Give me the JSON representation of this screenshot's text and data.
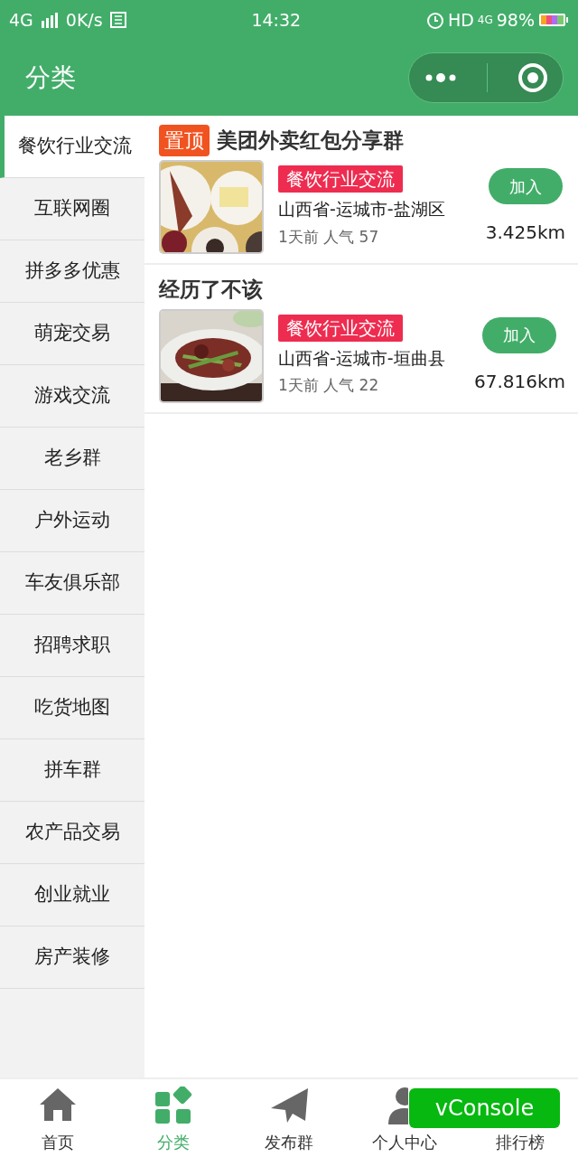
{
  "status_bar": {
    "network": "4G",
    "speed": "0K/s",
    "time": "14:32",
    "hd": "HD",
    "network_2": "4G",
    "battery": "98%"
  },
  "header": {
    "title": "分类"
  },
  "sidebar": {
    "items": [
      {
        "label": "餐饮行业交流",
        "selected": true
      },
      {
        "label": "互联网圈",
        "selected": false
      },
      {
        "label": "拼多多优惠",
        "selected": false
      },
      {
        "label": "萌宠交易",
        "selected": false
      },
      {
        "label": "游戏交流",
        "selected": false
      },
      {
        "label": "老乡群",
        "selected": false
      },
      {
        "label": "户外运动",
        "selected": false
      },
      {
        "label": "车友俱乐部",
        "selected": false
      },
      {
        "label": "招聘求职",
        "selected": false
      },
      {
        "label": "吃货地图",
        "selected": false
      },
      {
        "label": "拼车群",
        "selected": false
      },
      {
        "label": "农产品交易",
        "selected": false
      },
      {
        "label": "创业就业",
        "selected": false
      },
      {
        "label": "房产装修",
        "selected": false
      }
    ]
  },
  "groups": [
    {
      "pinned": "置顶",
      "title": "美团外卖红包分享群",
      "category": "餐饮行业交流",
      "location": "山西省-运城市-盐湖区",
      "meta": "1天前 人气 57",
      "join": "加入",
      "distance": "3.425km"
    },
    {
      "title": "经历了不该",
      "category": "餐饮行业交流",
      "location": "山西省-运城市-垣曲县",
      "meta": "1天前 人气 22",
      "join": "加入",
      "distance": "67.816km"
    }
  ],
  "tab_bar": [
    {
      "label": "首页",
      "kind": "home",
      "selected": false
    },
    {
      "label": "分类",
      "kind": "grid",
      "selected": true
    },
    {
      "label": "发布群",
      "kind": "plane",
      "selected": false
    },
    {
      "label": "个人中心",
      "kind": "person",
      "selected": false
    },
    {
      "label": "排行榜",
      "kind": "hidden",
      "selected": false
    }
  ],
  "vconsole": "vConsole"
}
